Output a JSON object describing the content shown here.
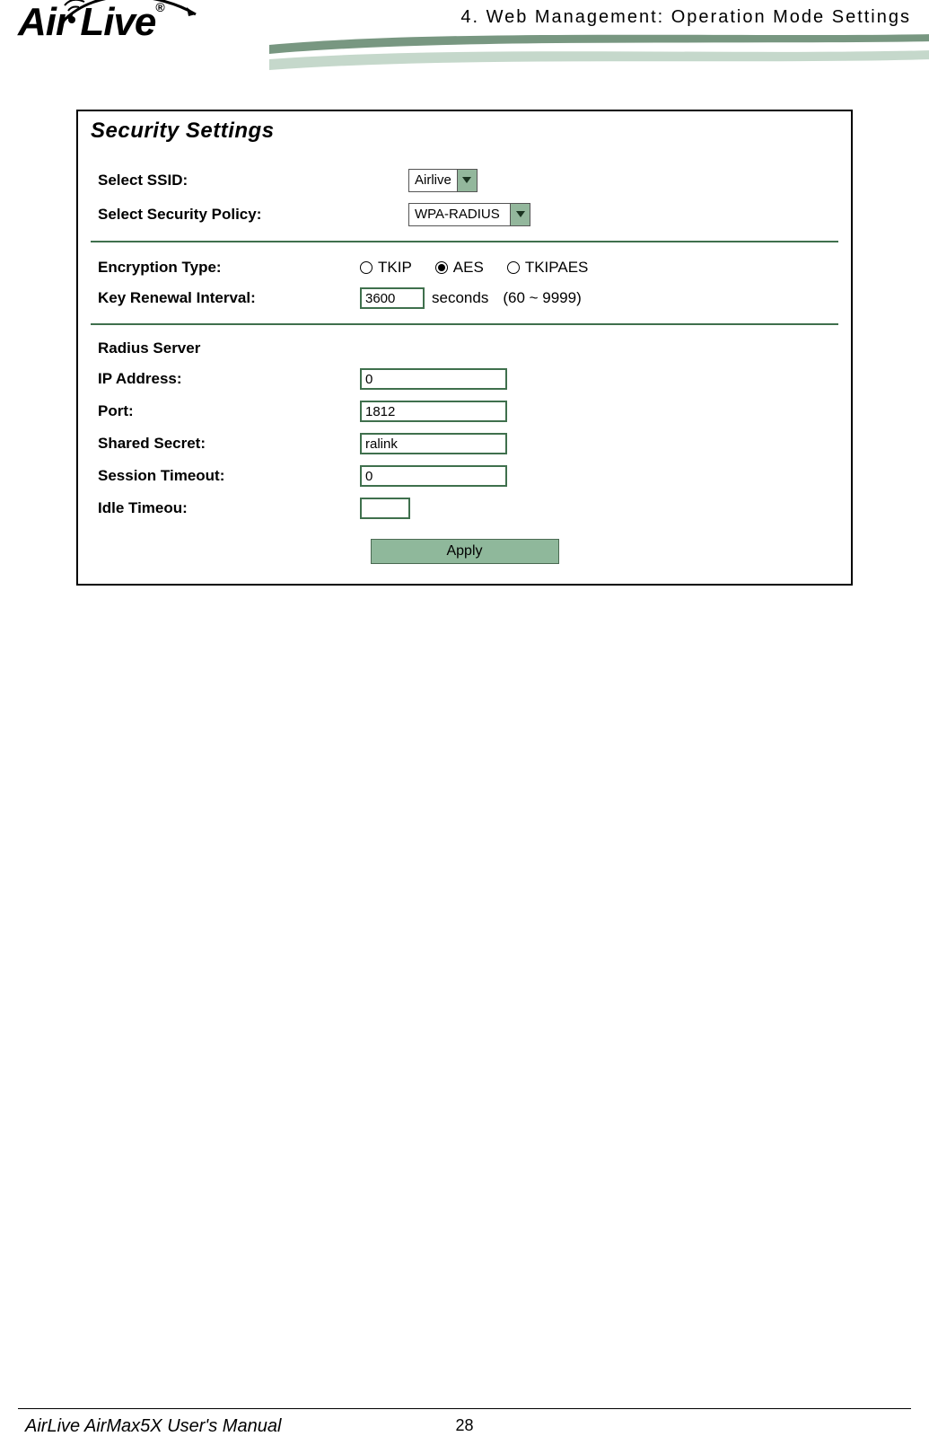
{
  "header": {
    "chapter": "4.  Web  Management:  Operation  Mode  Settings",
    "logo_text": "Air Live",
    "registered": "®"
  },
  "panel": {
    "title": "Security  Settings",
    "ssid_label": "Select SSID:",
    "ssid_value": "Airlive",
    "policy_label": "Select Security Policy:",
    "policy_value": "WPA-RADIUS",
    "encryption": {
      "label": "Encryption Type:",
      "options": {
        "tkip": "TKIP",
        "aes": "AES",
        "tkipaes": "TKIPAES"
      },
      "selected": "aes"
    },
    "key_renew": {
      "label": "Key Renewal Interval:",
      "value": "3600",
      "unit": "seconds",
      "range": "(60 ~ 9999)"
    },
    "radius": {
      "legend": "Radius Server",
      "ip_label": "IP Address:",
      "ip_value": "0",
      "port_label": "Port:",
      "port_value": "1812",
      "secret_label": "Shared Secret:",
      "secret_value": "ralink",
      "session_label": "Session Timeout:",
      "session_value": "0",
      "idle_label": "Idle Timeou:",
      "idle_value": ""
    },
    "apply_label": "Apply"
  },
  "footer": {
    "page_number": "28",
    "manual_title": "AirLive AirMax5X User's Manual"
  }
}
